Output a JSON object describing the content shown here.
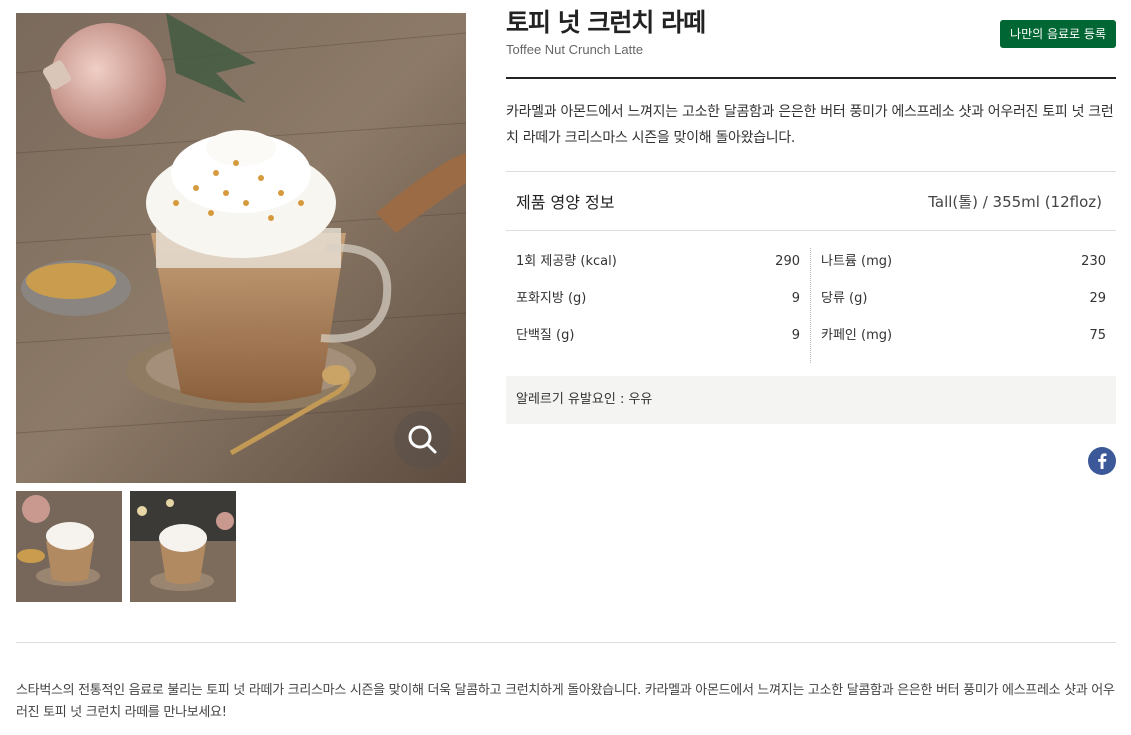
{
  "product": {
    "title_ko": "토피 넛 크런치 라떼",
    "title_en": "Toffee Nut Crunch Latte",
    "register_label": "나만의 음료로 등록",
    "description": "카라멜과 아몬드에서 느껴지는 고소한 달콤함과 은은한 버터 풍미가 에스프레소 샷과 어우러진 토피 넛 크런치 라떼가 크리스마스 시즌을 맞이해 돌아왔습니다."
  },
  "nutrition": {
    "title": "제품 영양 정보",
    "size": "Tall(톨) / 355ml (12floz)",
    "left": [
      {
        "label": "1회 제공량 (kcal)",
        "value": "290"
      },
      {
        "label": "포화지방 (g)",
        "value": "9"
      },
      {
        "label": "단백질 (g)",
        "value": "9"
      }
    ],
    "right": [
      {
        "label": "나트륨 (mg)",
        "value": "230"
      },
      {
        "label": "당류 (g)",
        "value": "29"
      },
      {
        "label": "카페인 (mg)",
        "value": "75"
      }
    ]
  },
  "allergy": "알레르기 유발요인 : 우유",
  "bottom_text": "스타벅스의 전통적인 음료로 불리는 토피 넛 라떼가 크리스마스 시즌을 맞이해 더욱 달콤하고 크런치하게 돌아왔습니다. 카라멜과 아몬드에서 느껴지는 고소한 달콤함과 은은한 버터 풍미가 에스프레소 샷과 어우러진 토피 넛 크런치 라떼를 만나보세요!",
  "icons": {
    "zoom": "magnifier-icon",
    "share": "facebook-icon"
  },
  "colors": {
    "brand_green": "#006633",
    "facebook": "#3b5998"
  }
}
